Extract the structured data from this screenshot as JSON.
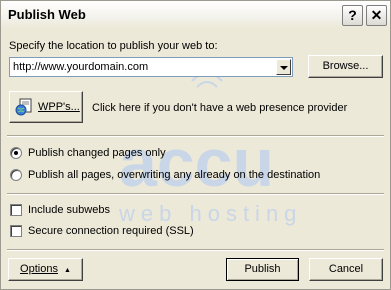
{
  "window": {
    "title": "Publish Web",
    "help_glyph": "?",
    "close_glyph": "✕"
  },
  "location": {
    "prompt": "Specify the location to publish your web to:",
    "value": "http://www.yourdomain.com",
    "browse_label": "Browse..."
  },
  "wpp": {
    "button_label": "WPP's...",
    "hint": "Click here if you don't have a web presence provider"
  },
  "publish_mode": {
    "options": [
      {
        "label": "Publish changed pages only",
        "checked": true
      },
      {
        "label": "Publish all pages, overwriting any already on the destination",
        "checked": false
      }
    ]
  },
  "checkboxes": [
    {
      "label": "Include subwebs",
      "checked": false
    },
    {
      "label": "Secure connection required (SSL)",
      "checked": false
    }
  ],
  "footer": {
    "options_label": "Options",
    "options_glyph": "▲",
    "publish_label": "Publish",
    "cancel_label": "Cancel"
  },
  "watermark": {
    "brand": "accu",
    "tagline": "web hosting",
    "color": "#c9d6e8"
  },
  "colors": {
    "dialog_bg": "#ece9d8",
    "field_border": "#7f9db9"
  },
  "icons": {
    "wpp": "globe-document-icon",
    "dropdown": "chevron-down-icon",
    "help": "help-icon",
    "close": "close-icon"
  }
}
